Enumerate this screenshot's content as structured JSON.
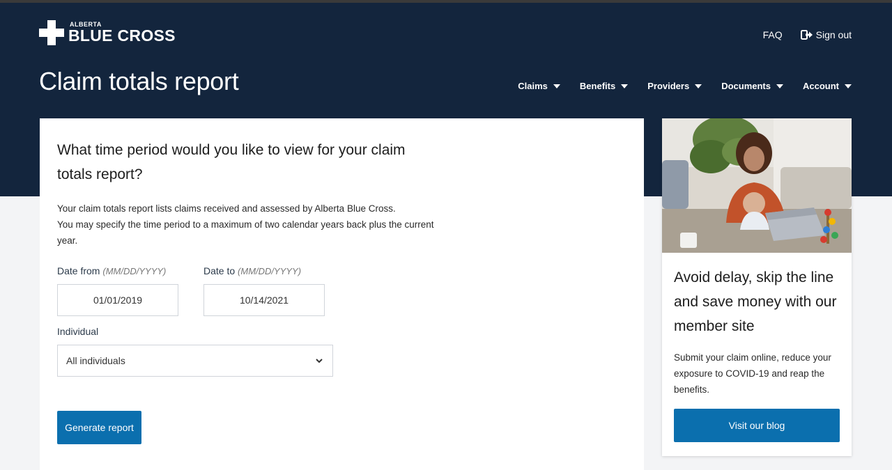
{
  "brand": {
    "small": "ALBERTA",
    "big": "BLUE CROSS"
  },
  "top_links": {
    "faq": "FAQ",
    "sign_out": "Sign out"
  },
  "page_title": "Claim totals report",
  "nav": [
    {
      "label": "Claims"
    },
    {
      "label": "Benefits"
    },
    {
      "label": "Providers"
    },
    {
      "label": "Documents"
    },
    {
      "label": "Account"
    }
  ],
  "form": {
    "question": "What time period would you like to view for your claim totals report?",
    "description_1": "Your claim totals report lists claims received and assessed by Alberta Blue Cross.",
    "description_2": "You may specify the time period to a maximum of two calendar years back plus the current year.",
    "date_from_label": "Date from",
    "date_from_hint": "(MM/DD/YYYY)",
    "date_from_value": "01/01/2019",
    "date_to_label": "Date to",
    "date_to_hint": "(MM/DD/YYYY)",
    "date_to_value": "10/14/2021",
    "individual_label": "Individual",
    "individual_value": "All individuals",
    "generate_label": "Generate report"
  },
  "promo": {
    "title": "Avoid delay, skip the line and save money with our member site",
    "description": "Submit your claim online, reduce your exposure to COVID-19 and reap the benefits.",
    "button_label": "Visit our blog"
  },
  "colors": {
    "header_bg": "#13253d",
    "accent": "#0b6fae"
  }
}
